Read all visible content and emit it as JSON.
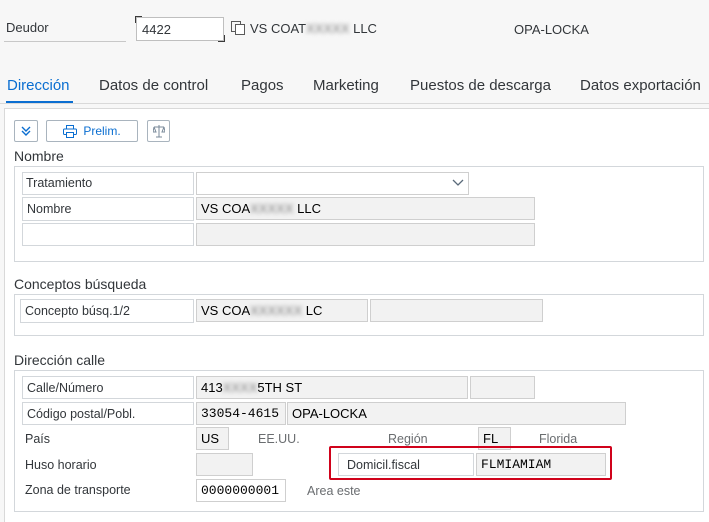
{
  "header": {
    "deudor_label": "Deudor",
    "deudor_value": "4422",
    "deudor_name_prefix": "VS COAT",
    "deudor_name_blur": "XXXXX",
    "deudor_name_suffix": "LLC",
    "city": "OPA-LOCKA"
  },
  "tabs": [
    {
      "label": "Dirección",
      "active": true
    },
    {
      "label": "Datos de control"
    },
    {
      "label": "Pagos"
    },
    {
      "label": "Marketing"
    },
    {
      "label": "Puestos de descarga"
    },
    {
      "label": "Datos exportación"
    }
  ],
  "toolbar": {
    "expand_icon": "double-chevron-down-icon",
    "prelim_label": "Prelim.",
    "printer_icon": "printer-icon",
    "scales_icon": "scales-icon"
  },
  "nombre": {
    "title": "Nombre",
    "tratamiento_label": "Tratamiento",
    "tratamiento_value": "",
    "nombre_label": "Nombre",
    "nombre_prefix": "VS COA",
    "nombre_blur": "XXXXX",
    "nombre_suffix": "LLC",
    "nombre2_value": ""
  },
  "busqueda": {
    "title": "Conceptos búsqueda",
    "concepto_label": "Concepto búsq.1/2",
    "concepto_prefix": "VS COA",
    "concepto_blur": "XXXXXX",
    "concepto_suffix": "LC",
    "concepto2_value": ""
  },
  "direccion": {
    "title": "Dirección calle",
    "calle_label": "Calle/Número",
    "calle_prefix": "413",
    "calle_blur": "XXXX",
    "calle_suffix": "5TH ST",
    "codigo_label": "Código postal/Pobl.",
    "codigo_value": "33054-4615",
    "poblacion_value": "OPA-LOCKA",
    "pais_label": "País",
    "pais_value": "US",
    "pais_desc": "EE.UU.",
    "region_label": "Región",
    "region_value": "FL",
    "region_desc": "Florida",
    "huso_label": "Huso horario",
    "huso_value": "",
    "domicil_label": "Domicil.fiscal",
    "domicil_value": "FLMIAMIAM",
    "zona_label": "Zona de transporte",
    "zona_value": "0000000001",
    "zona_desc": "Area este"
  },
  "colors": {
    "accent": "#0a6ed1",
    "highlight_border": "#d0021b"
  }
}
